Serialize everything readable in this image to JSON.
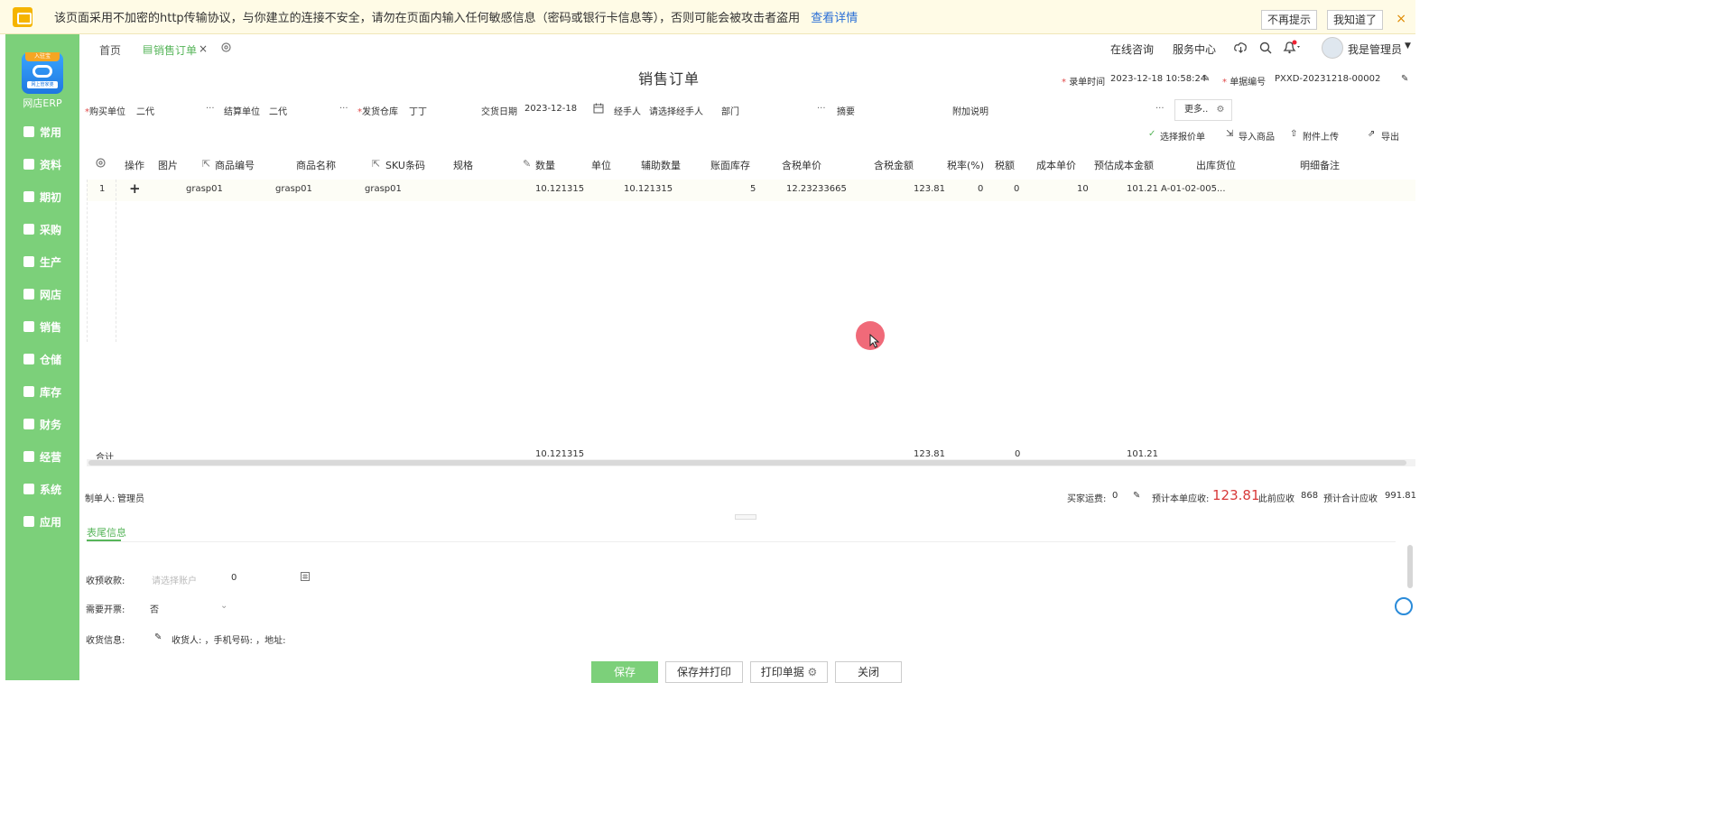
{
  "banner": {
    "message": "该页面采用不加密的http传输协议，与你建立的连接不安全，请勿在页面内输入任何敏感信息（密码或银行卡信息等），否则可能会被攻击者盗用",
    "link": "查看详情",
    "dont_remind": "不再提示",
    "got_it": "我知道了",
    "close": "×"
  },
  "sidebar": {
    "logo_badge": "入驻宝",
    "logo_sub": "网上管家婆",
    "app_name": "网店ERP",
    "items": [
      {
        "label": "常用",
        "icon": "star-icon"
      },
      {
        "label": "资料",
        "icon": "file-icon"
      },
      {
        "label": "期初",
        "icon": "clock-icon"
      },
      {
        "label": "采购",
        "icon": "cart-icon"
      },
      {
        "label": "生产",
        "icon": "production-icon"
      },
      {
        "label": "网店",
        "icon": "shop-icon"
      },
      {
        "label": "销售",
        "icon": "sales-chart-icon"
      },
      {
        "label": "仓储",
        "icon": "warehouse-icon"
      },
      {
        "label": "库存",
        "icon": "inventory-icon"
      },
      {
        "label": "财务",
        "icon": "finance-icon"
      },
      {
        "label": "经营",
        "icon": "business-icon"
      },
      {
        "label": "系统",
        "icon": "settings-icon"
      },
      {
        "label": "应用",
        "icon": "apps-icon"
      }
    ]
  },
  "tabs": {
    "home": "首页",
    "current": "销售订单",
    "close": "×"
  },
  "topbar": {
    "online_consult": "在线咨询",
    "service_center": "服务中心",
    "user": "我是管理员"
  },
  "page": {
    "title": "销售订单",
    "record_time_label": "录单时间",
    "record_time": "2023-12-18 10:58:24",
    "doc_no_label": "单据编号",
    "doc_no": "PXXD-20231218-00002"
  },
  "form": {
    "buyer_label": "购买单位",
    "buyer": "二代",
    "settle_label": "结算单位",
    "settle": "二代",
    "warehouse_label": "发货仓库",
    "warehouse": "丁丁",
    "delivery_date_label": "交货日期",
    "delivery_date": "2023-12-18",
    "handler_label": "经手人",
    "handler_placeholder": "请选择经手人",
    "dept_label": "部门",
    "summary_label": "摘要",
    "note_label": "附加说明",
    "more": "更多.."
  },
  "actions": {
    "select_quote": "选择报价单",
    "import_goods": "导入商品",
    "attach_upload": "附件上传",
    "export": "导出"
  },
  "table": {
    "headers": {
      "op": "操作",
      "image": "图片",
      "code": "商品编号",
      "name": "商品名称",
      "sku": "SKU条码",
      "spec": "规格",
      "qty": "数量",
      "unit": "单位",
      "aux_qty": "辅助数量",
      "book_stock": "账面库存",
      "tax_price": "含税单价",
      "tax_amount": "含税金额",
      "tax_rate": "税率(%)",
      "tax": "税额",
      "cost_price": "成本单价",
      "est_cost": "预估成本金额",
      "location": "出库货位",
      "remark": "明细备注"
    },
    "row": {
      "no": "1",
      "op": "+",
      "code": "grasp01",
      "name": "grasp01",
      "sku": "grasp01",
      "qty": "10.121315",
      "aux_qty": "10.121315",
      "book_stock": "5",
      "tax_price": "12.23233665",
      "tax_amount": "123.81",
      "tax_rate": "0",
      "tax": "0",
      "cost_price": "10",
      "est_cost": "101.21",
      "location": "A-01-02-005..."
    },
    "totals": {
      "label": "合计",
      "qty": "10.121315",
      "tax_amount": "123.81",
      "tax": "0",
      "est_cost": "101.21"
    }
  },
  "footer": {
    "maker_label": "制单人:",
    "maker": "管理员",
    "freight_label": "买家运费:",
    "freight": "0",
    "receivable_label": "预计本单应收:",
    "receivable": "123.81",
    "prev_label": "此前应收",
    "prev": "868",
    "total_label": "预计合计应收",
    "total": "991.81"
  },
  "tail": {
    "tab": "表尾信息",
    "prepay_label": "收预收款:",
    "account_placeholder": "请选择账户",
    "prepay_amount": "0",
    "invoice_label": "需要开票:",
    "invoice_value": "否",
    "ship_label": "收货信息:",
    "ship_text": "收货人: ，手机号码: ，地址:"
  },
  "buttons": {
    "save": "保存",
    "save_print": "保存并打印",
    "print": "打印单据",
    "close": "关闭"
  },
  "colors": {
    "brand_green": "#7cd07a",
    "accent_red": "#d83a3a",
    "link_blue": "#2a6fd6"
  }
}
